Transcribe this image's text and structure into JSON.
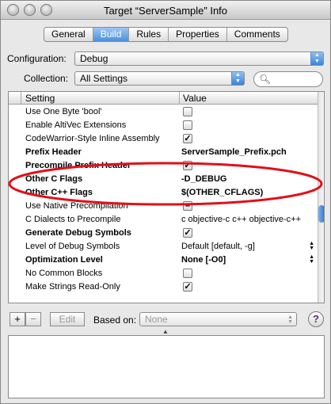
{
  "window": {
    "title": "Target “ServerSample” Info"
  },
  "tabs": [
    {
      "label": "General"
    },
    {
      "label": "Build",
      "selected": true
    },
    {
      "label": "Rules"
    },
    {
      "label": "Properties"
    },
    {
      "label": "Comments"
    }
  ],
  "configuration": {
    "label": "Configuration:",
    "value": "Debug"
  },
  "collection": {
    "label": "Collection:",
    "value": "All Settings"
  },
  "search": {
    "placeholder": ""
  },
  "table": {
    "headers": {
      "setting": "Setting",
      "value": "Value"
    },
    "rows": [
      {
        "setting": "Use One Byte 'bool'",
        "value": "",
        "kind": "checkbox",
        "checked": false,
        "bold": false
      },
      {
        "setting": "Enable AltiVec Extensions",
        "value": "",
        "kind": "checkbox",
        "checked": false,
        "bold": false
      },
      {
        "setting": "CodeWarrior-Style Inline Assembly",
        "value": "",
        "kind": "checkbox",
        "checked": true,
        "bold": false
      },
      {
        "setting": "Prefix Header",
        "value": "ServerSample_Prefix.pch",
        "kind": "text",
        "bold": true
      },
      {
        "setting": "Precompile Prefix Header",
        "value": "",
        "kind": "checkbox",
        "checked": true,
        "bold": true
      },
      {
        "setting": "Other C Flags",
        "value": "-D_DEBUG",
        "kind": "text",
        "bold": true
      },
      {
        "setting": "Other C++ Flags",
        "value": "$(OTHER_CFLAGS)",
        "kind": "text",
        "bold": true
      },
      {
        "setting": "Use Native Precompilation",
        "value": "",
        "kind": "checkbox",
        "checked": "mixed",
        "bold": false
      },
      {
        "setting": "C Dialects to Precompile",
        "value": "c objective-c c++ objective-c++",
        "kind": "text",
        "bold": false
      },
      {
        "setting": "Generate Debug Symbols",
        "value": "",
        "kind": "checkbox",
        "checked": true,
        "bold": true
      },
      {
        "setting": "Level of Debug Symbols",
        "value": "Default [default, -g]",
        "kind": "popup",
        "bold": false
      },
      {
        "setting": "Optimization Level",
        "value": "None [-O0]",
        "kind": "popup",
        "bold": true
      },
      {
        "setting": "No Common Blocks",
        "value": "",
        "kind": "checkbox",
        "checked": false,
        "bold": false
      },
      {
        "setting": "Make Strings Read-Only",
        "value": "",
        "kind": "checkbox",
        "checked": true,
        "bold": false
      }
    ]
  },
  "bottom": {
    "add_label": "+",
    "remove_label": "−",
    "edit_label": "Edit",
    "based_on_label": "Based on:",
    "based_on_value": "None",
    "help_label": "?"
  },
  "colors": {
    "annotation": "#e0101a",
    "accent": "#3c84d6"
  }
}
